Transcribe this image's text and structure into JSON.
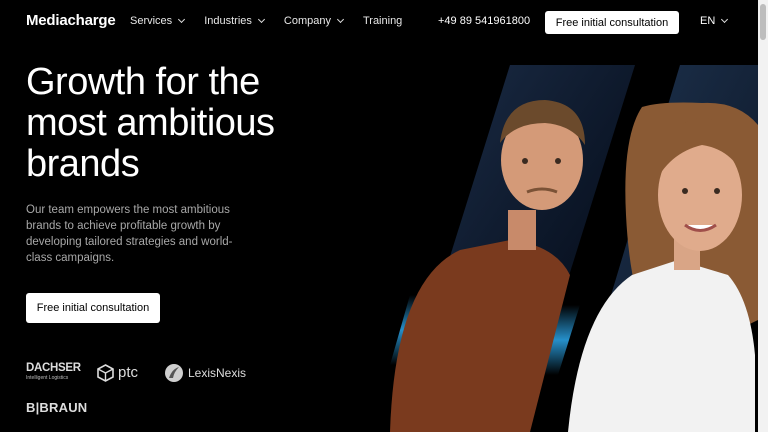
{
  "header": {
    "logo": "Mediacharge",
    "nav": [
      {
        "label": "Services",
        "has_dropdown": true
      },
      {
        "label": "Industries",
        "has_dropdown": true
      },
      {
        "label": "Company",
        "has_dropdown": true
      },
      {
        "label": "Training",
        "has_dropdown": false
      }
    ],
    "phone": "+49 89 541961800",
    "cta_label": "Free initial consultation",
    "language": "EN"
  },
  "hero": {
    "title_lines": [
      "Growth for the",
      "most ambitious",
      "brands"
    ],
    "description": "Our team empowers the most ambitious brands to achieve profitable growth by developing tailored strategies and world-class campaigns.",
    "cta_label": "Free initial consultation"
  },
  "client_logos": {
    "dachser": {
      "name": "DACHSER",
      "sub": "Intelligent Logistics"
    },
    "ptc": "ptc",
    "lexisnexis": "LexisNexis",
    "braun": "B|BRAUN"
  },
  "icons": {
    "dropdown": "chevron-down-icon",
    "ptc_mark": "ptc-logo-icon",
    "lexis_mark": "lexisnexis-logo-icon"
  },
  "colors": {
    "background": "#000000",
    "text": "#ffffff",
    "muted_text": "#a8a8a8",
    "button_bg": "#ffffff",
    "accent_blue": "#2a9fe0"
  }
}
